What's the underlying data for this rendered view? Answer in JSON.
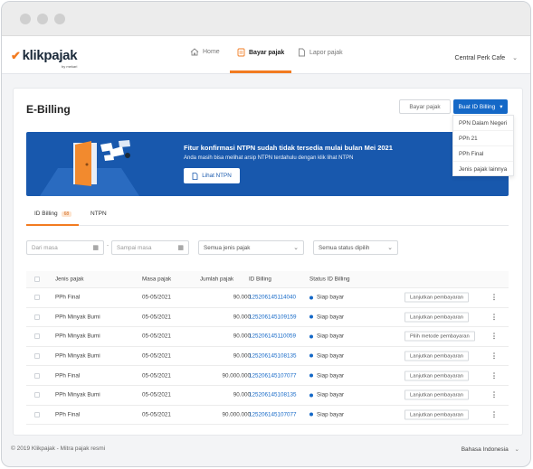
{
  "brand": {
    "name": "klikpajak",
    "tagline": "by mekari"
  },
  "nav": {
    "items": [
      {
        "label": "Home"
      },
      {
        "label": "Bayar pajak"
      },
      {
        "label": "Lapor pajak"
      }
    ],
    "company": "Central Perk Cafe"
  },
  "page": {
    "title": "E-Billing"
  },
  "actions": {
    "bayar_label": "Bayar pajak",
    "buat_label": "Buat ID Billing",
    "menu": [
      "PPN Dalam Negeri",
      "PPh 21",
      "PPh Final",
      "Jenis pajak lainnya"
    ]
  },
  "banner": {
    "headline": "Fitur konfirmasi NTPN sudah tidak tersedia mulai bulan Mei 2021",
    "sub": "Anda masih bisa melihat arsip NTPN terdahulu dengan klik lihat NTPN",
    "button": "Lihat NTPN"
  },
  "tabs": [
    {
      "label": "ID Billing",
      "badge": "68"
    },
    {
      "label": "NTPN"
    }
  ],
  "filters": {
    "dari_masa": "Dari masa",
    "sampai_masa": "Sampai masa",
    "separator": "-",
    "jenis": "Semua jenis pajak",
    "status": "Semua status dipilih"
  },
  "table": {
    "headers": [
      "Jenis pajak",
      "Masa pajak",
      "Jumlah pajak",
      "ID Billing",
      "Status ID Billing"
    ],
    "rows": [
      {
        "jenis": "PPh Final",
        "masa": "05-05/2021",
        "jumlah": "90.000",
        "id": "125206145114040",
        "status": "Siap bayar",
        "action": "Lanjutkan pembayaran"
      },
      {
        "jenis": "PPh Minyak Bumi",
        "masa": "05-05/2021",
        "jumlah": "90.000",
        "id": "125206145109159",
        "status": "Siap bayar",
        "action": "Lanjutkan pembayaran"
      },
      {
        "jenis": "PPh Minyak Bumi",
        "masa": "05-05/2021",
        "jumlah": "90.000",
        "id": "125206145110059",
        "status": "Siap bayar",
        "action": "Pilih metode pembayaran"
      },
      {
        "jenis": "PPh Minyak Bumi",
        "masa": "05-05/2021",
        "jumlah": "90.000",
        "id": "125206145108135",
        "status": "Siap bayar",
        "action": "Lanjutkan pembayaran"
      },
      {
        "jenis": "PPh Final",
        "masa": "05-05/2021",
        "jumlah": "90.000.000",
        "id": "125206145107077",
        "status": "Siap bayar",
        "action": "Lanjutkan pembayaran"
      },
      {
        "jenis": "PPh Minyak Bumi",
        "masa": "05-05/2021",
        "jumlah": "90.000",
        "id": "125206145108135",
        "status": "Siap bayar",
        "action": "Lanjutkan pembayaran"
      },
      {
        "jenis": "PPh Final",
        "masa": "05-05/2021",
        "jumlah": "90.000.000",
        "id": "125206145107077",
        "status": "Siap bayar",
        "action": "Lanjutkan pembayaran"
      }
    ]
  },
  "footer": {
    "copyright": "© 2019 Klikpajak - Mitra pajak resmi",
    "language": "Bahasa Indonesia"
  },
  "colors": {
    "accent": "#f27b20",
    "primary": "#1468c7",
    "banner": "#1858ad"
  }
}
